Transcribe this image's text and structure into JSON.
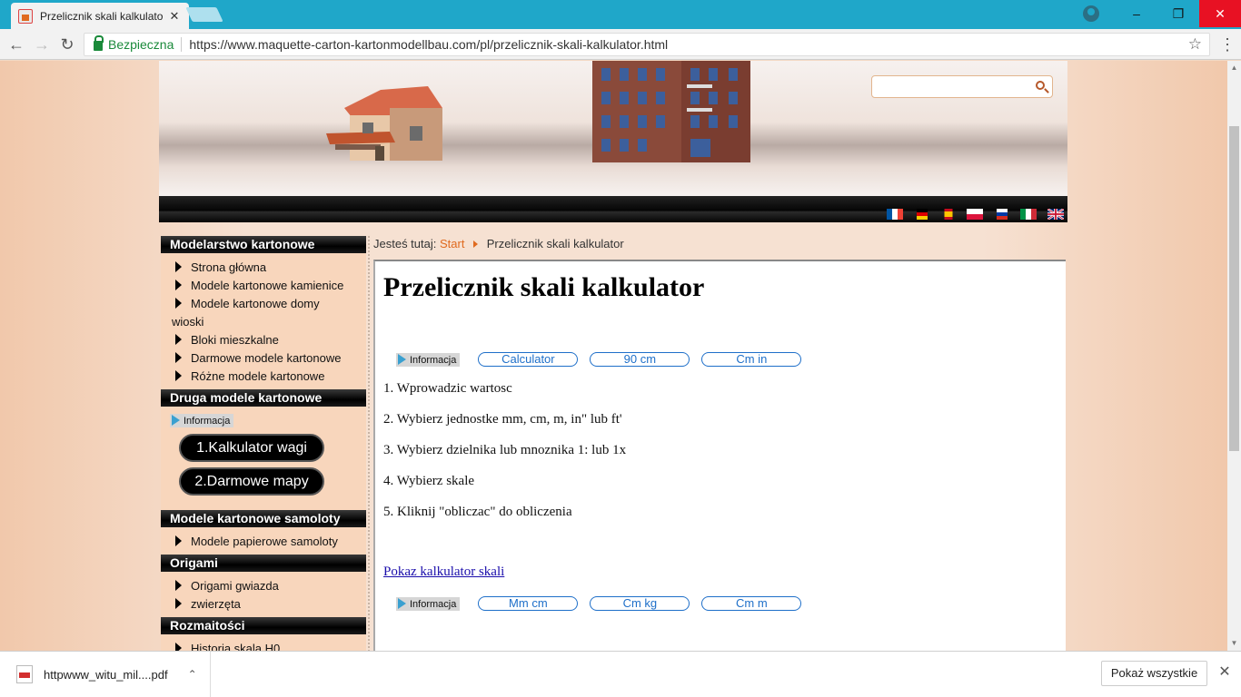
{
  "browser": {
    "tab_title": "Przelicznik skali kalkulato",
    "secure_label": "Bezpieczna",
    "url": "https://www.maquette-carton-kartonmodellbau.com/pl/przelicznik-skali-kalkulator.html"
  },
  "sidebar": {
    "sections": [
      {
        "title": "Modelarstwo kartonowe",
        "items": [
          "Strona główna",
          "Modele kartonowe kamienice",
          "Modele kartonowe domy",
          "wioski",
          "Bloki mieszkalne",
          "Darmowe modele kartonowe",
          "Różne modele kartonowe"
        ]
      },
      {
        "title": "Druga modele kartonowe",
        "info_label": "Informacja",
        "buttons": [
          "1.Kalkulator wagi",
          "2.Darmowe mapy"
        ]
      },
      {
        "title": "Modele kartonowe samoloty",
        "items": [
          "Modele papierowe samoloty"
        ]
      },
      {
        "title": "Origami",
        "items": [
          "Origami gwiazda",
          "zwierzęta"
        ]
      },
      {
        "title": "Rozmaitości",
        "items": [
          "Historia skala H0"
        ]
      }
    ]
  },
  "breadcrumb": {
    "prefix": "Jesteś tutaj:",
    "start": "Start",
    "current": "Przelicznik skali kalkulator"
  },
  "main": {
    "title": "Przelicznik skali kalkulator",
    "info_label": "Informacja",
    "top_buttons": [
      "Calculator",
      "90 cm",
      "Cm in"
    ],
    "steps": [
      "1. Wprowadzic wartosc",
      "2. Wybierz jednostke mm, cm, m, in\" lub ft'",
      "3. Wybierz dzielnika lub mnoznika 1: lub 1x",
      "4. Wybierz skale",
      "5. Kliknij \"obliczac\" do obliczenia"
    ],
    "link": "Pokaz kalkulator skali",
    "bottom_buttons": [
      "Mm cm",
      "Cm kg",
      "Cm m"
    ]
  },
  "download_bar": {
    "file_name": "httpwww_witu_mil....pdf",
    "show_all": "Pokaż wszystkie"
  }
}
